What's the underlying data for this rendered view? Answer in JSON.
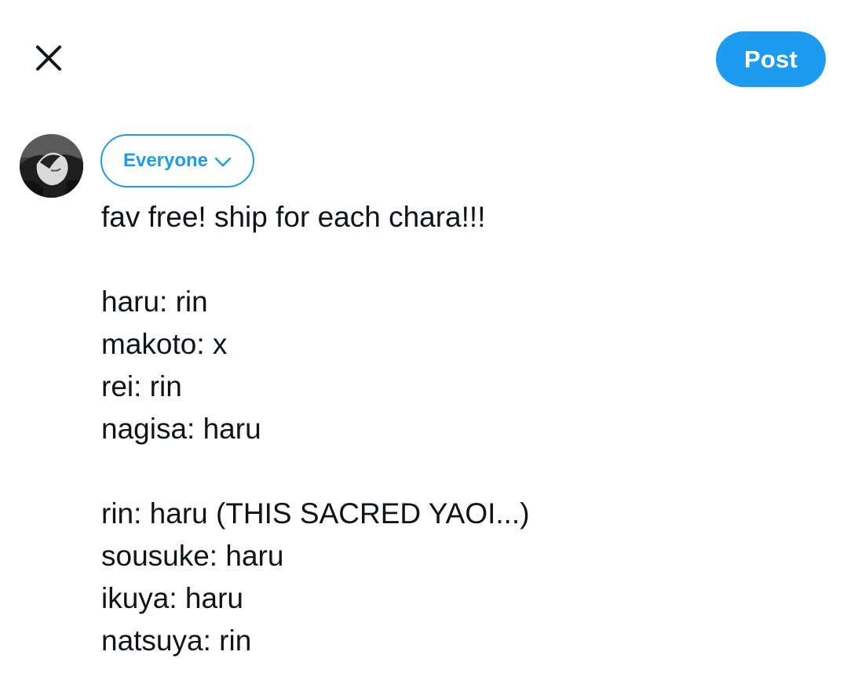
{
  "header": {
    "close_icon": "close-icon",
    "post_label": "Post",
    "accent_color": "#1d9bf0"
  },
  "composer": {
    "avatar_icon": "profile-avatar",
    "audience_label": "Everyone",
    "audience_icon": "chevron-down-icon",
    "lines": [
      "fav free! ship for each chara!!!",
      "",
      "haru: rin",
      "makoto: x",
      "rei: rin",
      "nagisa: haru",
      "",
      "rin: haru (THIS SACRED YAOI...)",
      "sousuke: haru",
      "ikuya: haru",
      "natsuya: rin"
    ]
  }
}
